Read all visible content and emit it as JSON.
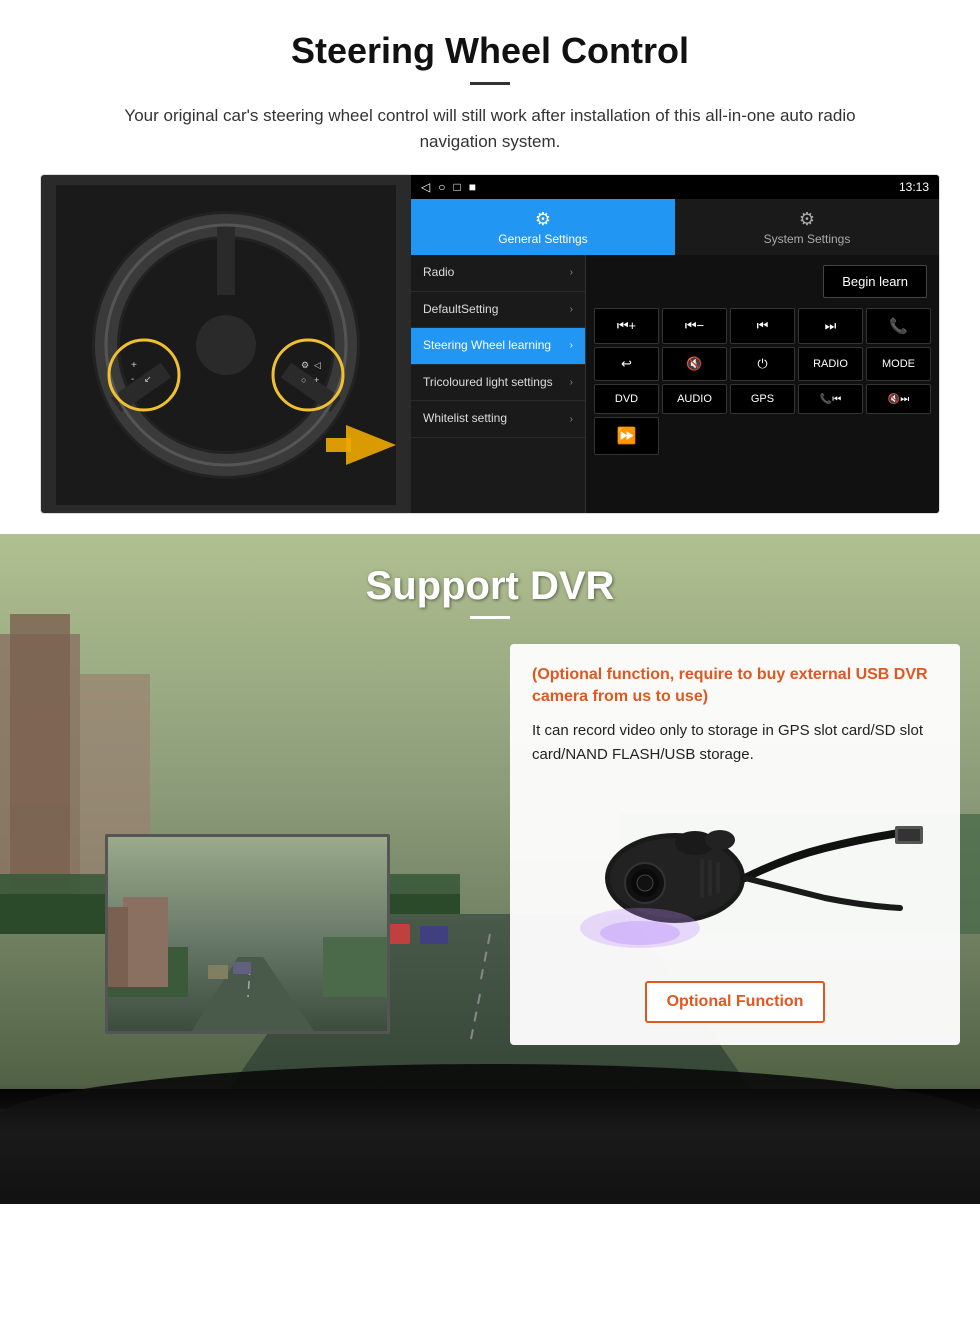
{
  "steering": {
    "title": "Steering Wheel Control",
    "subtitle": "Your original car's steering wheel control will still work after installation of this all-in-one auto radio navigation system.",
    "status_bar": {
      "time": "13:13",
      "icons": [
        "◁",
        "○",
        "□",
        "■"
      ]
    },
    "tabs": {
      "general": {
        "label": "General Settings",
        "icon": "⚙"
      },
      "system": {
        "label": "System Settings",
        "icon": "🔧"
      }
    },
    "menu_items": [
      {
        "label": "Radio",
        "active": false
      },
      {
        "label": "DefaultSetting",
        "active": false
      },
      {
        "label": "Steering Wheel learning",
        "active": true
      },
      {
        "label": "Tricoloured light settings",
        "active": false
      },
      {
        "label": "Whitelist setting",
        "active": false
      }
    ],
    "begin_learn_label": "Begin learn",
    "control_buttons": [
      "⏮+",
      "⏮-",
      "⏮|",
      "|⏭",
      "📞",
      "↩",
      "🔇",
      "⏻",
      "RADIO",
      "MODE",
      "DVD",
      "AUDIO",
      "GPS",
      "📞⏮|",
      "🔇⏭"
    ]
  },
  "dvr": {
    "title": "Support DVR",
    "optional_text": "(Optional function, require to buy external USB DVR camera from us to use)",
    "desc_text": "It can record video only to storage in GPS slot card/SD slot card/NAND FLASH/USB storage.",
    "optional_function_btn": "Optional Function"
  }
}
